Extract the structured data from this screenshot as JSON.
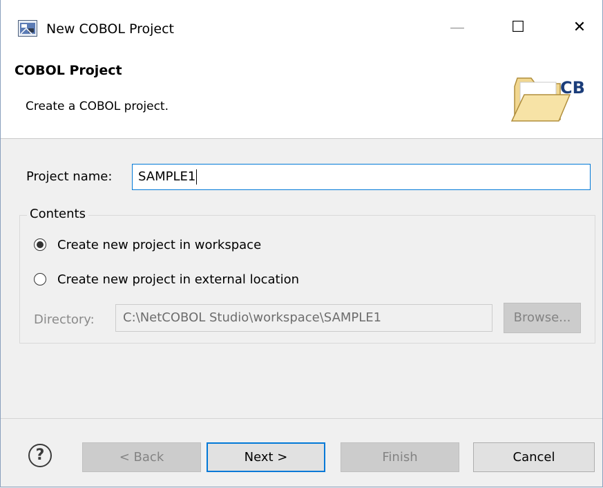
{
  "window": {
    "title": "New COBOL Project",
    "controls": {
      "minimize": "—",
      "maximize": "☐",
      "close": "✕"
    }
  },
  "banner": {
    "title": "COBOL Project",
    "description": "Create a COBOL project.",
    "icon_label": "CB"
  },
  "form": {
    "project_name_label": "Project name:",
    "project_name_value": "SAMPLE1",
    "contents_group": {
      "title": "Contents",
      "option_workspace": "Create new project in workspace",
      "option_external": "Create new project in external location",
      "selected": "workspace"
    },
    "directory_label": "Directory:",
    "directory_value": "C:\\NetCOBOL Studio\\workspace\\SAMPLE1",
    "browse_label": "Browse..."
  },
  "buttons": {
    "help": "?",
    "back": "< Back",
    "next": "Next >",
    "finish": "Finish",
    "cancel": "Cancel"
  },
  "colors": {
    "accent": "#0078d7",
    "window_bg": "#f0f0f0",
    "banner_bg": "#ffffff"
  }
}
